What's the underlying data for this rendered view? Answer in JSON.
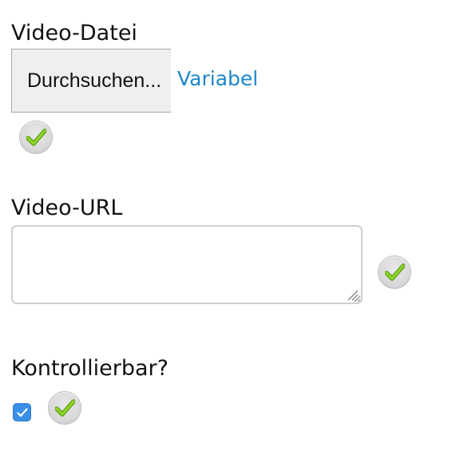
{
  "video_file": {
    "label": "Video-Datei",
    "browse_button_label": "Durchsuchen...",
    "variable_link_label": "Variabel",
    "status_icon": "check-badge-icon"
  },
  "video_url": {
    "label": "Video-URL",
    "value": "",
    "placeholder": "",
    "status_icon": "check-badge-icon"
  },
  "controllable": {
    "label": "Kontrollierbar?",
    "checked": true,
    "status_icon": "check-badge-icon"
  },
  "colors": {
    "link": "#1c87c9",
    "checkbox_accent": "#3a8ee6",
    "check_green": "#7cc621"
  }
}
